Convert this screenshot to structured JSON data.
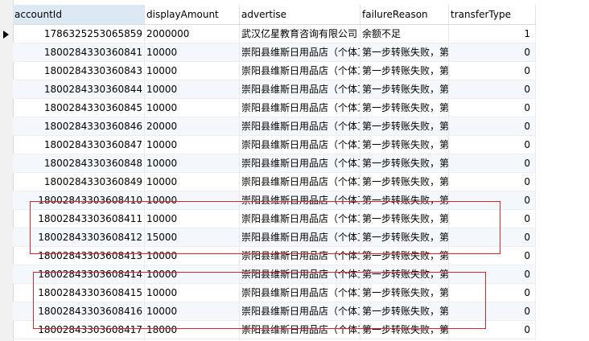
{
  "columns": [
    "accountId",
    "displayAmount",
    "advertise",
    "failureReason",
    "transferType"
  ],
  "rows": [
    [
      "1786325253065859",
      "2000000",
      "武汉亿星教育咨询有限公司",
      "余额不足",
      "1"
    ],
    [
      "1800284330360841",
      "10000",
      "崇阳县维斯日用品店（个体工",
      "第一步转账失败，第",
      "0"
    ],
    [
      "1800284330360843",
      "10000",
      "崇阳县维斯日用品店（个体工",
      "第一步转账失败，第",
      "0"
    ],
    [
      "1800284330360844",
      "10000",
      "崇阳县维斯日用品店（个体工",
      "第一步转账失败，第",
      "0"
    ],
    [
      "1800284330360845",
      "10000",
      "崇阳县维斯日用品店（个体工",
      "第一步转账失败，第",
      "0"
    ],
    [
      "1800284330360846",
      "20000",
      "崇阳县维斯日用品店（个体工",
      "第一步转账失败，第",
      "0"
    ],
    [
      "1800284330360847",
      "10000",
      "崇阳县维斯日用品店（个体工",
      "第一步转账失败，第",
      "0"
    ],
    [
      "1800284330360848",
      "10000",
      "崇阳县维斯日用品店（个体工",
      "第一步转账失败，第",
      "0"
    ],
    [
      "1800284330360849",
      "10000",
      "崇阳县维斯日用品店（个体工",
      "第一步转账失败，第",
      "0"
    ],
    [
      "18002843303608410",
      "10000",
      "崇阳县维斯日用品店（个体工",
      "第一步转账失败，第",
      "0"
    ],
    [
      "18002843303608411",
      "10000",
      "崇阳县维斯日用品店（个体工",
      "第一步转账失败，第",
      "0"
    ],
    [
      "18002843303608412",
      "15000",
      "崇阳县维斯日用品店（个体工",
      "第一步转账失败，第",
      "0"
    ],
    [
      "18002843303608413",
      "10000",
      "崇阳县维斯日用品店（个体工",
      "第一步转账失败，第",
      "0"
    ],
    [
      "18002843303608414",
      "10000",
      "崇阳县维斯日用品店（个体工",
      "第一步转账失败，第",
      "0"
    ],
    [
      "18002843303608415",
      "10000",
      "崇阳县维斯日用品店（个体工",
      "第一步转账失败，第",
      "0"
    ],
    [
      "18002843303608416",
      "10000",
      "崇阳县维斯日用品店（个体工",
      "第一步转账失败，第",
      "0"
    ],
    [
      "18002843303608417",
      "18000",
      "崇阳县维斯日用品店（个体工",
      "第一步转账失败，第",
      "0"
    ]
  ],
  "colors": {
    "highlight_border": "#d9252b",
    "selected_header": "#dde8f5",
    "alt_row": "#f4f8fc"
  }
}
